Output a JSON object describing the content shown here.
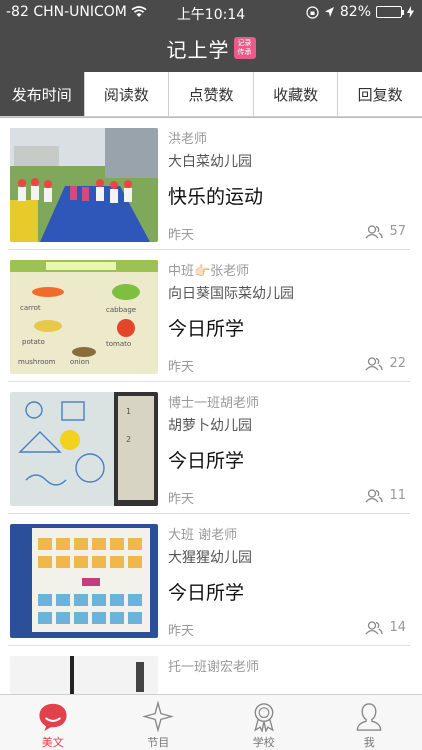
{
  "status_bar": {
    "carrier": "-82 CHN-UNICOM",
    "time": "上午10:14",
    "battery": "82%",
    "battery_level": 0.82,
    "icons": [
      "wifi-icon",
      "lock-rotation-icon",
      "location-icon",
      "charging-icon"
    ]
  },
  "nav": {
    "title": "记上学",
    "badge_line1": "记录",
    "badge_line2": "传承"
  },
  "sort_tabs": [
    {
      "label": "发布时间",
      "active": true
    },
    {
      "label": "阅读数",
      "active": false
    },
    {
      "label": "点赞数",
      "active": false
    },
    {
      "label": "收藏数",
      "active": false
    },
    {
      "label": "回复数",
      "active": false
    }
  ],
  "posts": [
    {
      "teacher": "洪老师",
      "school": "大白菜幼儿园",
      "title": "快乐的运动",
      "date": "昨天",
      "reads": "57"
    },
    {
      "teacher": "中班👉🏻张老师",
      "school": "向日葵国际菜幼儿园",
      "title": "今日所学",
      "date": "昨天",
      "reads": "22"
    },
    {
      "teacher": "博士一班胡老师",
      "school": "胡萝卜幼儿园",
      "title": "今日所学",
      "date": "昨天",
      "reads": "11"
    },
    {
      "teacher": "大班 谢老师",
      "school": "大猩猩幼儿园",
      "title": "今日所学",
      "date": "昨天",
      "reads": "14"
    },
    {
      "teacher": "托一班谢宏老师"
    }
  ],
  "bottom_tabs": [
    {
      "label": "美文",
      "icon": "chat-bubble-icon",
      "active": true
    },
    {
      "label": "节目",
      "icon": "star-icon",
      "active": false
    },
    {
      "label": "学校",
      "icon": "award-icon",
      "active": false
    },
    {
      "label": "我",
      "icon": "person-icon",
      "active": false
    }
  ],
  "colors": {
    "header_bg": "#4a4a4a",
    "accent_red": "#e0414a",
    "badge_pink": "#e95b8a"
  }
}
